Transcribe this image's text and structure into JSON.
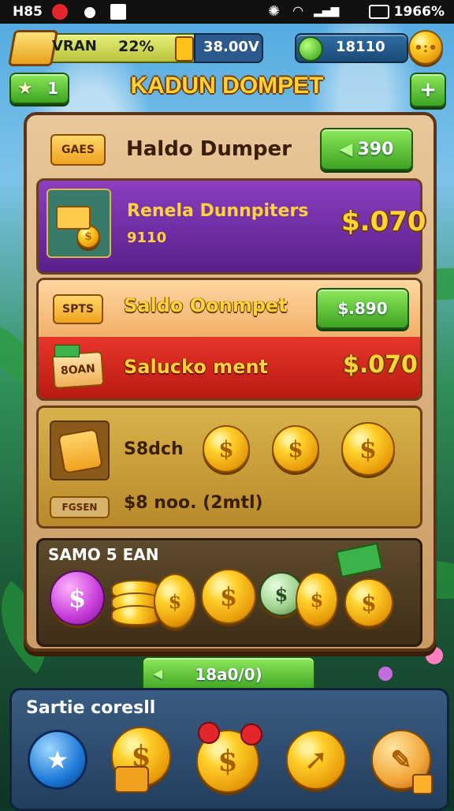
{
  "status_bar": {
    "left_text": "H85",
    "right_text": "1966%"
  },
  "hud": {
    "player_name": "VRAN",
    "progress_percent": "22%",
    "progress_value": 22,
    "currency_primary": "38.00V",
    "currency_secondary": "18110",
    "left_button_count": "1"
  },
  "title": "KADUN DOMPET",
  "header_row": {
    "tag": "GAES",
    "label": "Haldo Dumper",
    "button": "390"
  },
  "purple_row": {
    "label": "Renela Dunnpiters",
    "sublabel": "9110",
    "amount": "$.070"
  },
  "orange_row": {
    "tag": "SPTS",
    "label": "Saldo Oonmpet",
    "button": "$.890"
  },
  "red_row": {
    "tag": "8OAN",
    "label": "Salucko ment",
    "amount": "$.070"
  },
  "gold_panel": {
    "label": "S8dch",
    "tag": "FGSEN",
    "footer": "$8 noo. (2mtl)"
  },
  "bank_panel": {
    "title": "SAMO 5 EAN"
  },
  "bottom_button": "18a0/0)",
  "bottom_bar": {
    "title": "Sartie coresll"
  },
  "icons": [
    "gold-bar-icon",
    "coin-icon",
    "dollar-coin-icon",
    "cash-note-icon",
    "bag-icon",
    "star-icon",
    "arrow-icon",
    "chevron-icon"
  ],
  "colors": {
    "accent_gold": "#ffd23a",
    "panel_brown": "#5a3318",
    "purple": "#6a2a9a",
    "red": "#d42a1c",
    "green": "#3da322"
  }
}
